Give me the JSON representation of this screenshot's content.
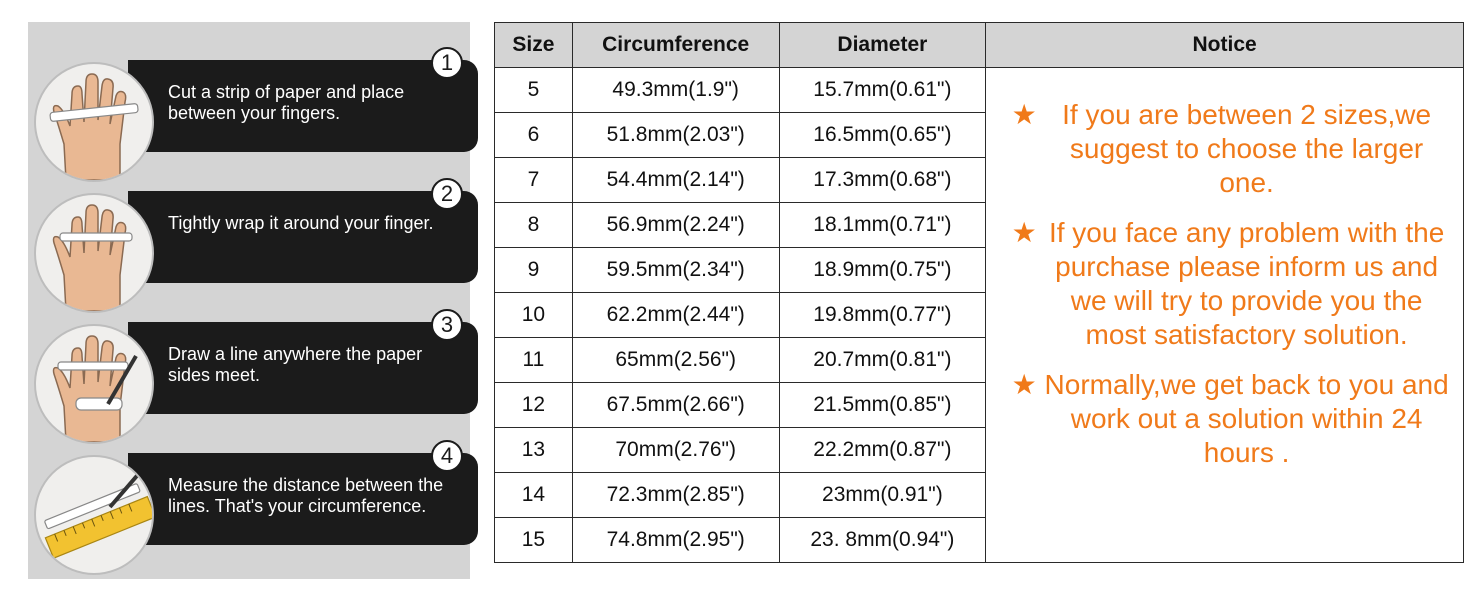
{
  "steps": [
    {
      "number": "1",
      "text": "Cut a strip of paper and place between your fingers.",
      "icon": "hand-paper-strip-icon"
    },
    {
      "number": "2",
      "text": "Tightly wrap it around your finger.",
      "icon": "hand-wrap-icon"
    },
    {
      "number": "3",
      "text": "Draw a line anywhere the paper sides meet.",
      "icon": "hand-pen-mark-icon"
    },
    {
      "number": "4",
      "text": "Measure the distance between the lines. That's your circumference.",
      "icon": "ruler-measure-icon"
    }
  ],
  "table": {
    "headers": {
      "size": "Size",
      "circumference": "Circumference",
      "diameter": "Diameter",
      "notice": "Notice"
    },
    "rows": [
      {
        "size": "5",
        "circumference": "49.3mm(1.9\")",
        "diameter": "15.7mm(0.61\")"
      },
      {
        "size": "6",
        "circumference": "51.8mm(2.03\")",
        "diameter": "16.5mm(0.65\")"
      },
      {
        "size": "7",
        "circumference": "54.4mm(2.14\")",
        "diameter": "17.3mm(0.68\")"
      },
      {
        "size": "8",
        "circumference": "56.9mm(2.24\")",
        "diameter": "18.1mm(0.71\")"
      },
      {
        "size": "9",
        "circumference": "59.5mm(2.34\")",
        "diameter": "18.9mm(0.75\")"
      },
      {
        "size": "10",
        "circumference": "62.2mm(2.44\")",
        "diameter": "19.8mm(0.77\")"
      },
      {
        "size": "11",
        "circumference": "65mm(2.56\")",
        "diameter": "20.7mm(0.81\")"
      },
      {
        "size": "12",
        "circumference": "67.5mm(2.66\")",
        "diameter": "21.5mm(0.85\")"
      },
      {
        "size": "13",
        "circumference": "70mm(2.76\")",
        "diameter": "22.2mm(0.87\")"
      },
      {
        "size": "14",
        "circumference": "72.3mm(2.85\")",
        "diameter": "23mm(0.91\")"
      },
      {
        "size": "15",
        "circumference": "74.8mm(2.95\")",
        "diameter": "23. 8mm(0.94\")"
      }
    ]
  },
  "notices": [
    {
      "star": "★",
      "text": "If you are between 2 sizes,we suggest to choose the larger one."
    },
    {
      "star": "★",
      "text": "If you face any problem with the purchase please inform us and we will try to provide you the most satisfactory solution."
    },
    {
      "star": "★",
      "text": "Normally,we get back to you and work out a solution within 24 hours ."
    }
  ],
  "colors": {
    "accent": "#f07a1a",
    "panel": "#d4d4d4",
    "bar": "#1b1b1b"
  }
}
